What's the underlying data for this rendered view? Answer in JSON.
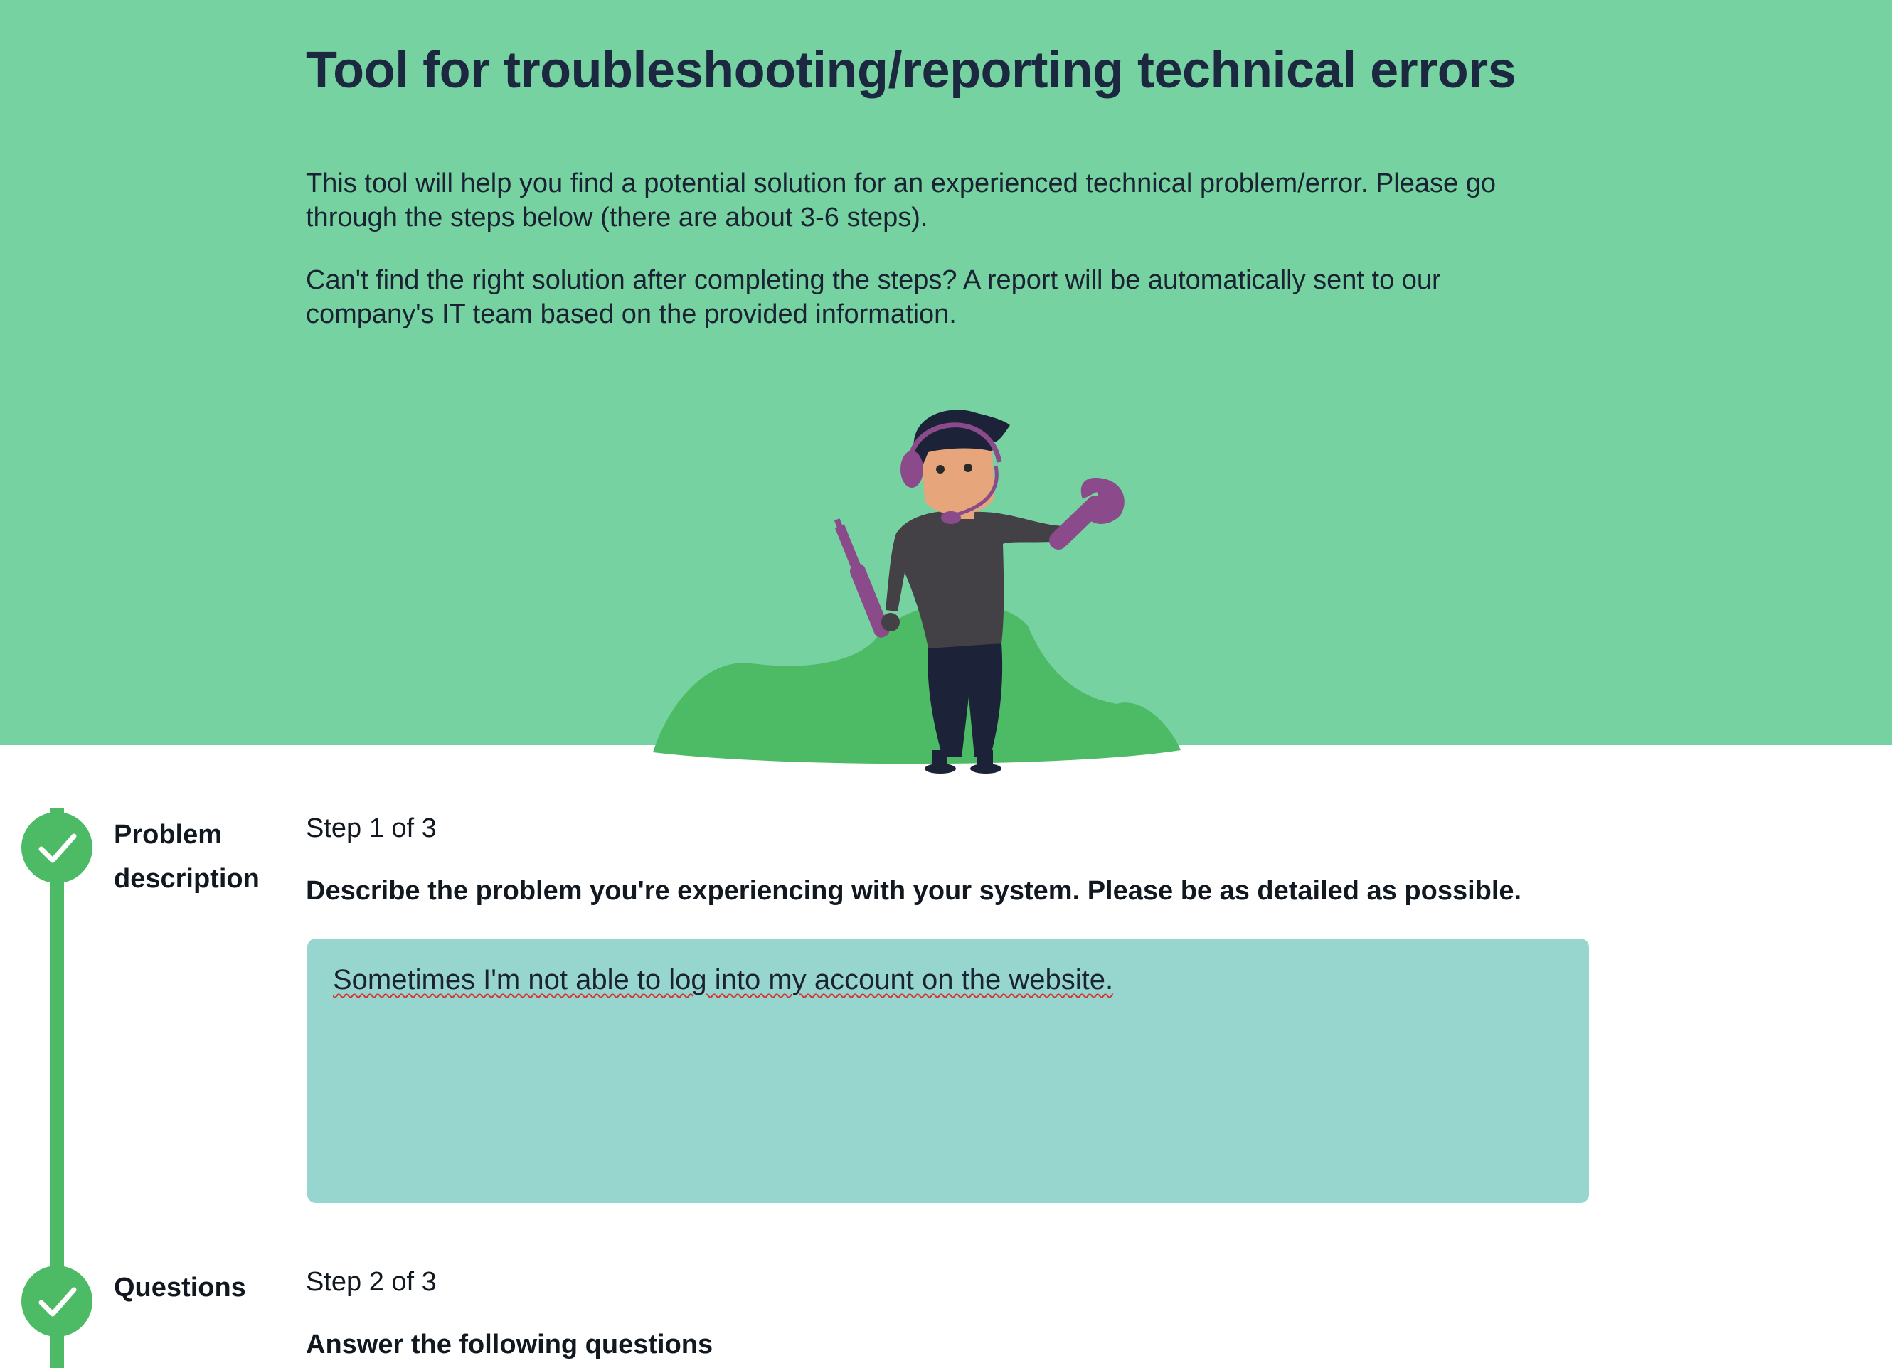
{
  "hero": {
    "title": "Tool for troubleshooting/reporting technical errors",
    "paragraph1": "This tool will help you find a potential solution for an experienced technical problem/error. Please go through the steps below (there are about 3-6 steps).",
    "paragraph2": "Can't find the right solution after completing the steps? A report will be automatically sent to our company's IT team based on the provided information.",
    "illustration_icon": "technician-with-tools",
    "background_color": "#76d3a1"
  },
  "steps": [
    {
      "name": "Problem description",
      "count": "Step 1 of 3",
      "question": "Describe the problem you're experiencing with your system. Please be as detailed as possible.",
      "answer": "Sometimes I'm not able to log into my account on the website.",
      "status_icon": "checkmark-icon",
      "completed": true
    },
    {
      "name": "Questions",
      "count": "Step 2 of 3",
      "question": "Answer the following questions",
      "status_icon": "checkmark-icon",
      "completed": true
    }
  ],
  "colors": {
    "accent_green": "#4dbb65",
    "answer_box": "#97d5cf",
    "title_text": "#1c2740"
  }
}
